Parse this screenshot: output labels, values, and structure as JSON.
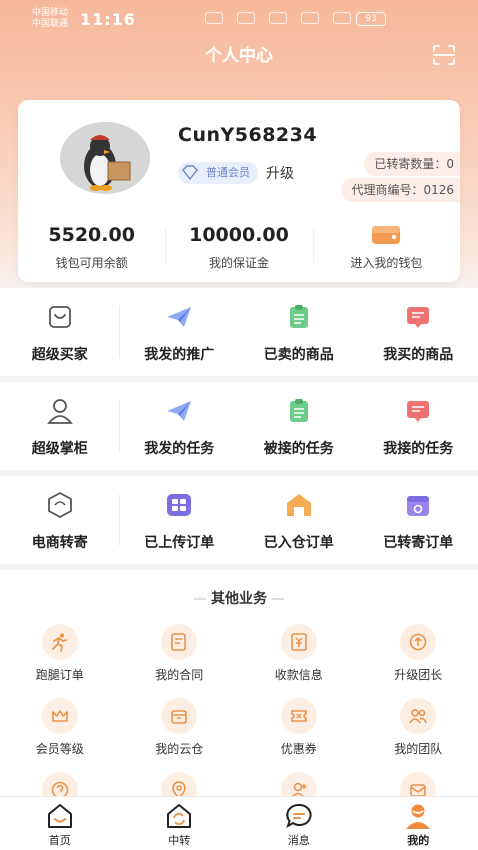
{
  "status_bar": {
    "carrier_1": "中国移动",
    "carrier_2": "中国联通",
    "time": "11:16",
    "battery": "93"
  },
  "header": {
    "title": "个人中心"
  },
  "profile": {
    "username": "CunY568234",
    "member_level": "普通会员",
    "upgrade_label": "升级",
    "transferred_count": "已转寄数量：0",
    "agent_number": "代理商编号：0126"
  },
  "wallet": {
    "balance_value": "5520.00",
    "balance_label": "钱包可用余额",
    "deposit_value": "10000.00",
    "deposit_label": "我的保证金",
    "enter_wallet_label": "进入我的钱包"
  },
  "buyer_row": {
    "lead_label": "超级买家",
    "items": [
      "我发的推广",
      "已卖的商品",
      "我买的商品"
    ]
  },
  "keeper_row": {
    "lead_label": "超级掌柜",
    "items": [
      "我发的任务",
      "被接的任务",
      "我接的任务"
    ]
  },
  "ecom_row": {
    "lead_label": "电商转寄",
    "items": [
      "已上传订单",
      "已入仓订单",
      "已转寄订单"
    ]
  },
  "other_business": {
    "title": "其他业务",
    "items": [
      {
        "label": "跑腿订单",
        "icon": "runner-icon"
      },
      {
        "label": "我的合同",
        "icon": "contract-icon"
      },
      {
        "label": "收款信息",
        "icon": "payment-icon"
      },
      {
        "label": "升级团长",
        "icon": "upgrade-icon"
      },
      {
        "label": "会员等级",
        "icon": "crown-icon"
      },
      {
        "label": "我的云仓",
        "icon": "warehouse-icon"
      },
      {
        "label": "优惠券",
        "icon": "coupon-icon"
      },
      {
        "label": "我的团队",
        "icon": "team-icon"
      }
    ]
  },
  "tabbar": {
    "home": "首页",
    "transfer": "中转",
    "messages": "消息",
    "mine": "我的"
  },
  "colors": {
    "accent_orange": "#f0a36a",
    "header_gradient": "#f6b89b",
    "icon_blue": "#6d8fe8",
    "icon_green": "#5cc07a",
    "icon_red": "#ef6a6a",
    "icon_purple": "#7b6ee0"
  }
}
